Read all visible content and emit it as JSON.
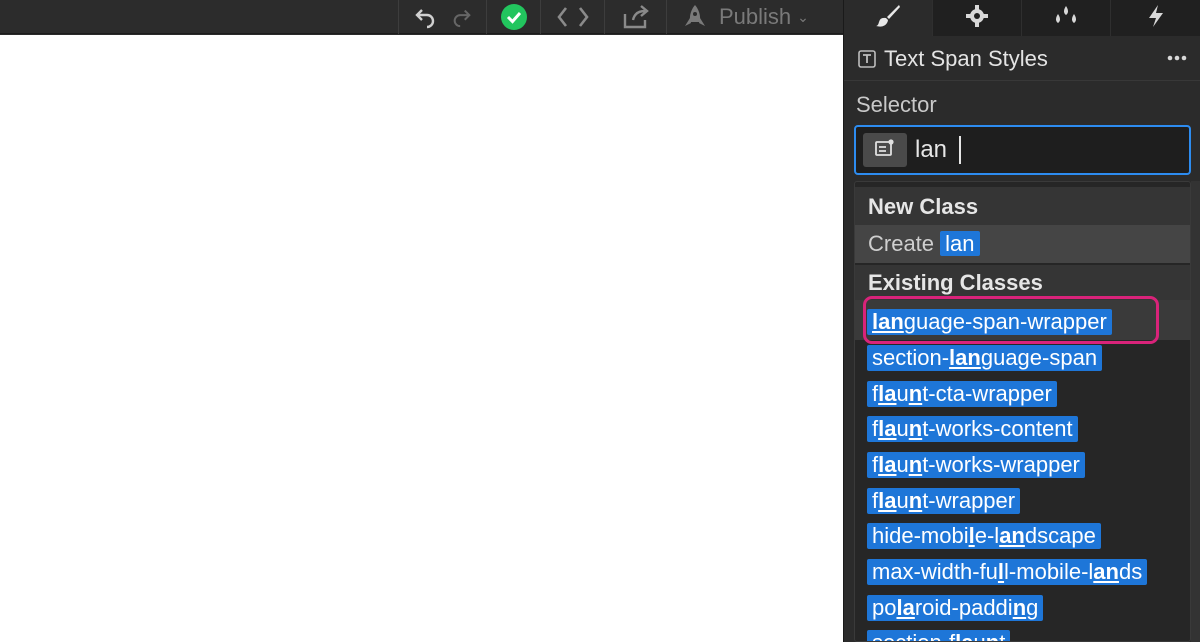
{
  "toolbar": {
    "icons": [
      "undo-icon",
      "redo-icon",
      "check-circle-icon",
      "code-icon",
      "export-icon",
      "rocket-icon"
    ],
    "publish_label": "Publish",
    "status_color": "#22c55e"
  },
  "panel": {
    "tabs": [
      "brush-icon",
      "gear-icon",
      "drops-icon",
      "lightning-icon"
    ],
    "title": "Text Span Styles",
    "more": "more-icon"
  },
  "selector": {
    "label": "Selector",
    "value": "lan"
  },
  "dropdown": {
    "new_class_heading": "New Class",
    "create_label": "Create",
    "create_value": "lan",
    "existing_heading": "Existing Classes",
    "items": [
      "language-span-wrapper",
      "section-language-span",
      "flaunt-cta-wrapper",
      "flaunt-works-content",
      "flaunt-works-wrapper",
      "flaunt-wrapper",
      "hide-mobile-landscape",
      "max-width-full-mobile-lands",
      "polaroid-padding",
      "section-flaunt"
    ]
  },
  "colors": {
    "accent": "#1e76d8",
    "focus_border": "#2d8cf0",
    "highlight_ring": "#d9237a"
  }
}
